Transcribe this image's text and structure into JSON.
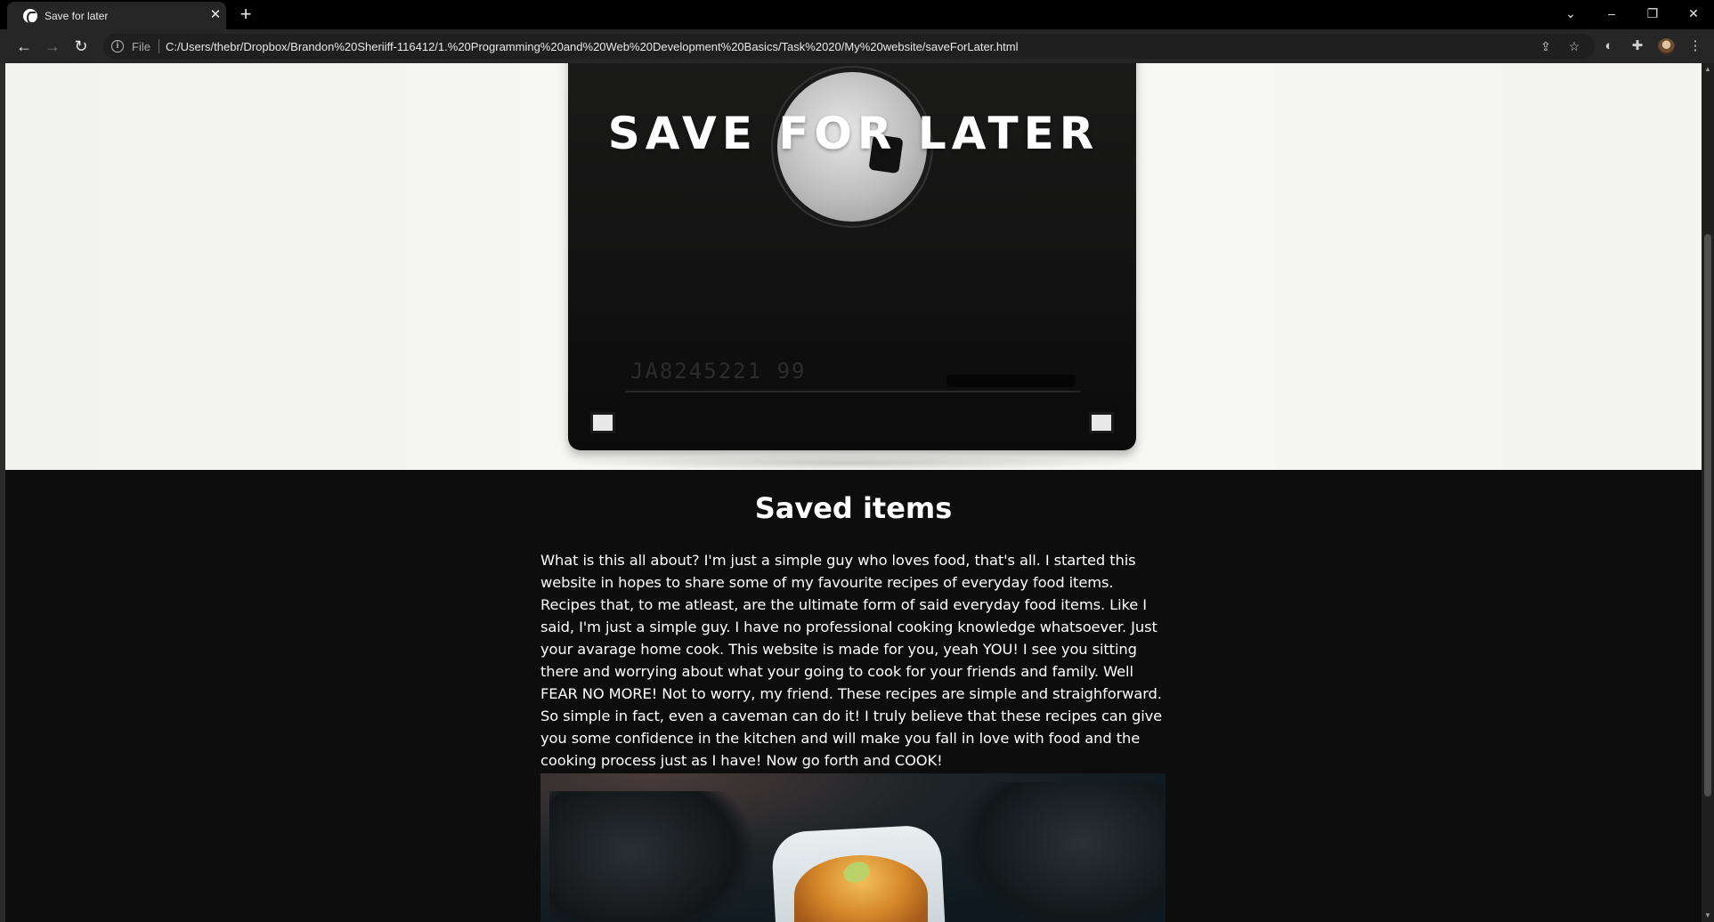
{
  "browser": {
    "tab": {
      "title": "Save for later",
      "favicon": "globe-icon"
    },
    "address": {
      "scheme_label": "File",
      "url": "C:/Users/thebr/Dropbox/Brandon%20Sheriiff-116412/1.%20Programming%20and%20Web%20Development%20Basics/Task%2020/My%20website/saveForLater.html"
    },
    "icons": [
      "back-arrow-icon",
      "forward-arrow-icon",
      "reload-icon",
      "info-icon",
      "share-icon",
      "star-icon",
      "extension-icon",
      "puzzle-icon",
      "profile-avatar",
      "kebab-menu-icon"
    ]
  },
  "page": {
    "hero_title": "SAVE FOR LATER",
    "disk_serial": "JA8245221 99",
    "section_heading": "Saved items",
    "intro": "What is this all about? I'm just a simple guy who loves food, that's all. I started this website in hopes to share some of my favourite recipes of everyday food items. Recipes that, to me atleast, are the ultimate form of said everyday food items. Like I said, I'm just a simple guy. I have no professional cooking knowledge whatsoever. Just your avarage home cook. This website is made for you, yeah YOU! I see you sitting there and worrying about what your going to cook for your friends and family. Well FEAR NO MORE! Not to worry, my friend. These recipes are simple and straighforward. So simple in fact, even a caveman can do it! I truly believe that these recipes can give you some confidence in the kitchen and will make you fall in love with food and the cooking process just as I have! Now go forth and COOK!"
  },
  "colors": {
    "page_background": "#0d0d0d",
    "chrome_background": "#262626",
    "text": "#ffffff"
  }
}
